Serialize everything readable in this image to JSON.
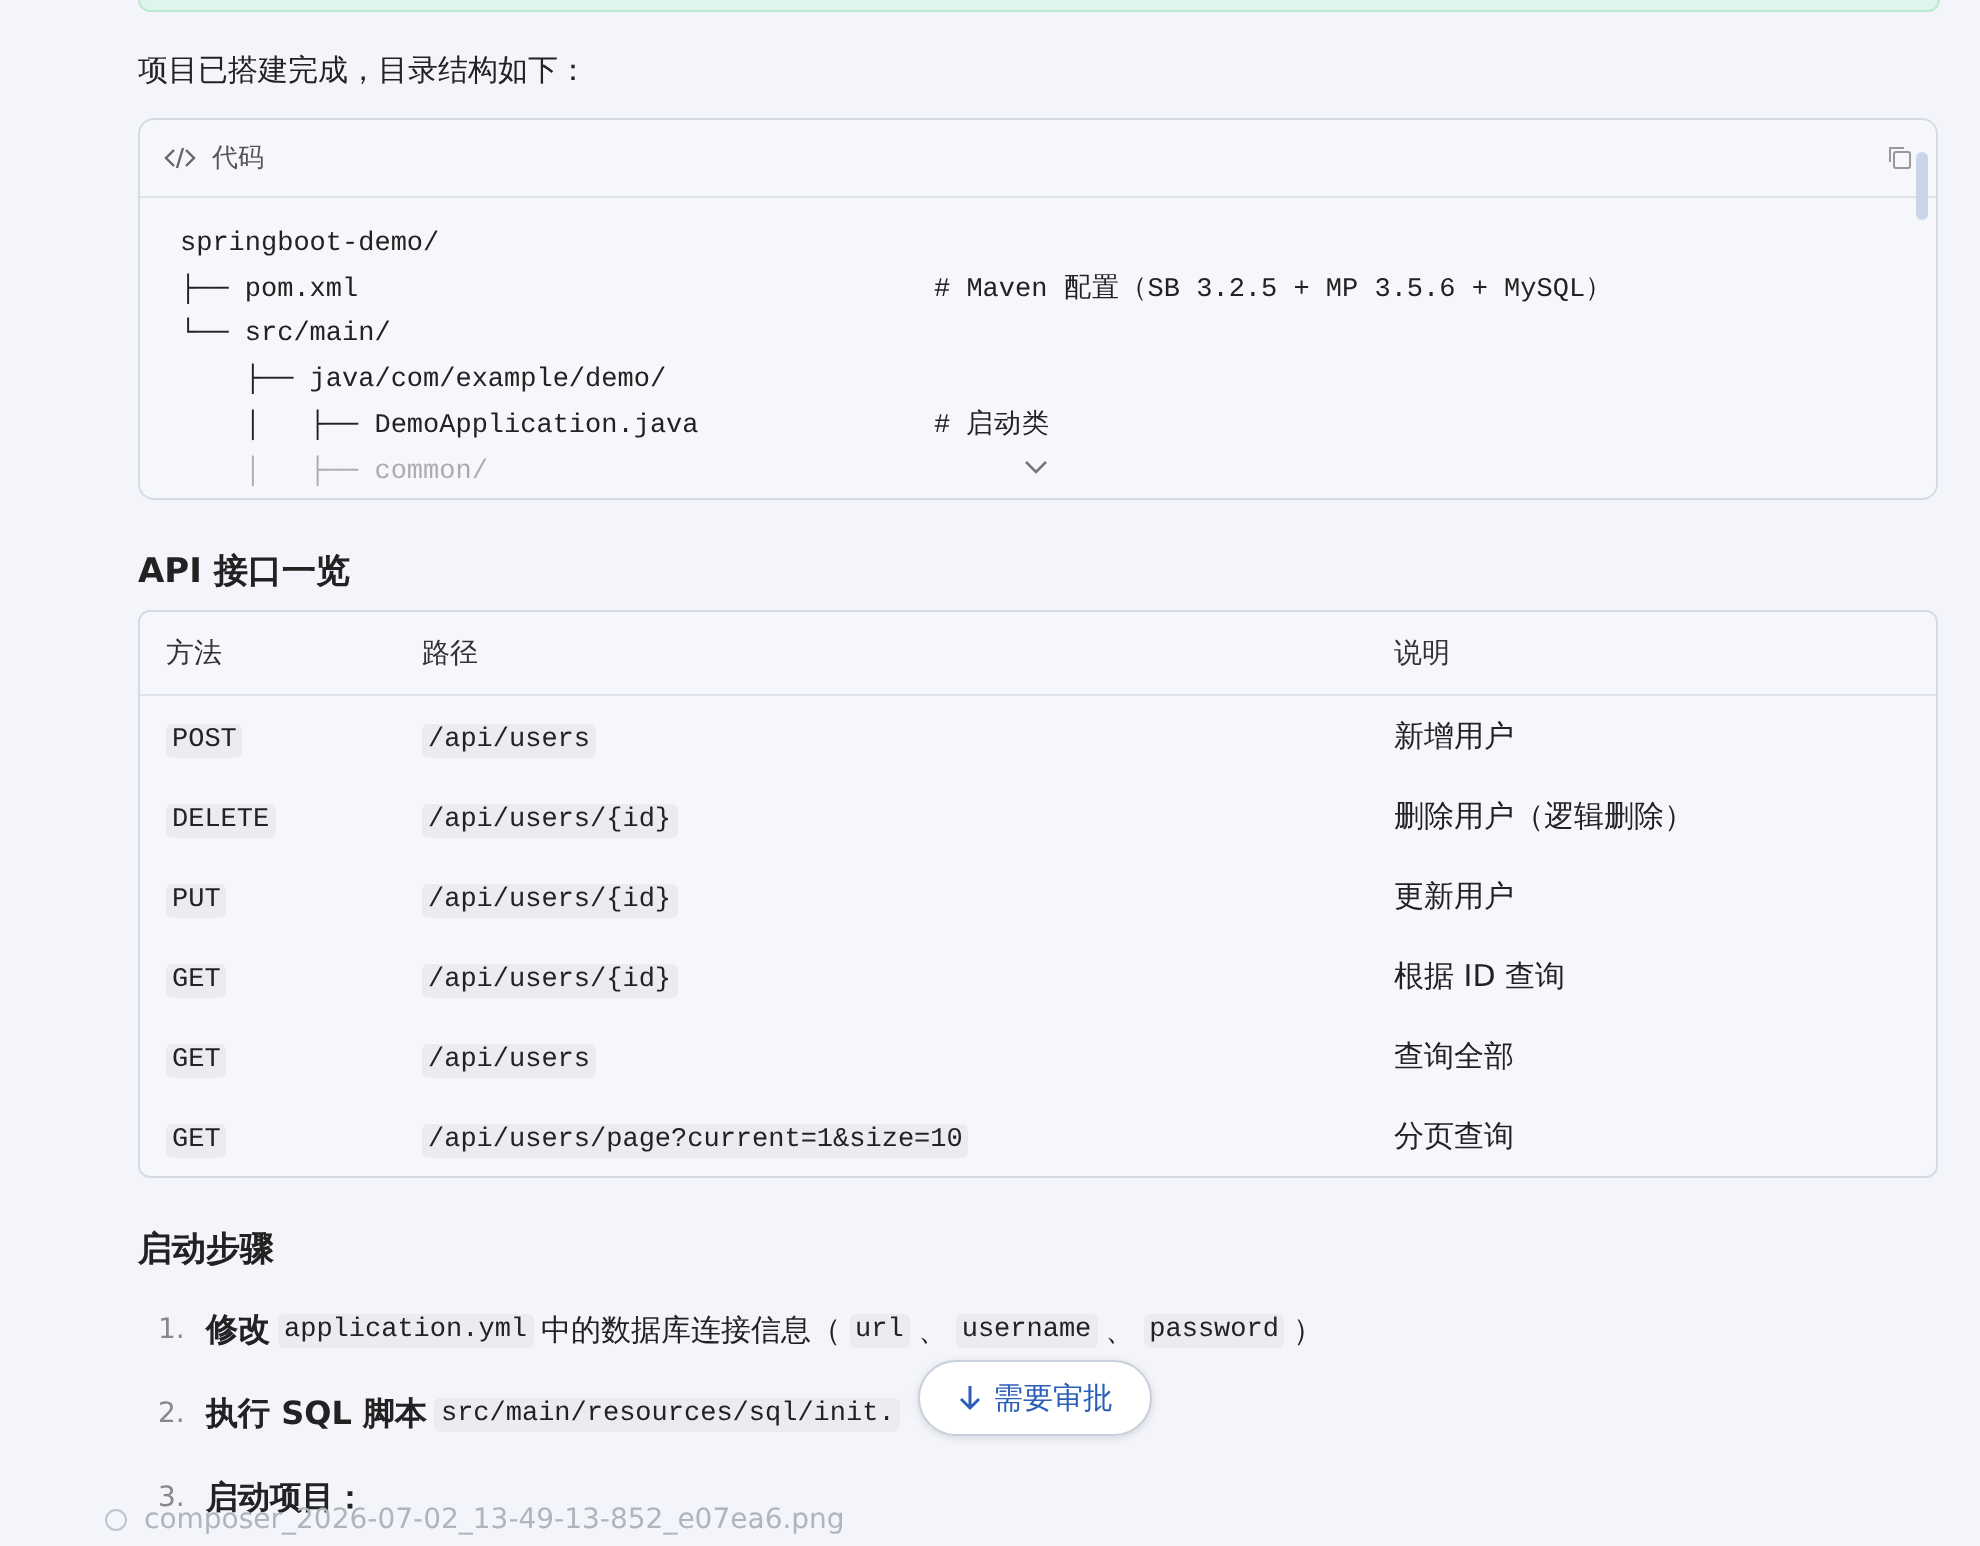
{
  "intro": "项目已搭建完成，目录结构如下：",
  "code_block": {
    "language_label": "代码",
    "lines": [
      {
        "text": "springboot-demo/",
        "faded": false
      },
      {
        "text": "├── pom.xml",
        "comment": "# Maven 配置（SB 3.2.5 + MP 3.5.6 + MySQL）",
        "faded": false
      },
      {
        "text": "└── src/main/",
        "faded": false
      },
      {
        "text": "    ├── java/com/example/demo/",
        "faded": false
      },
      {
        "text": "    │   ├── DemoApplication.java",
        "comment": "# 启动类",
        "faded": false
      },
      {
        "text": "    │   ├── common/",
        "faded": true
      }
    ]
  },
  "api_heading": "API 接口一览",
  "table": {
    "columns": [
      "方法",
      "路径",
      "说明"
    ],
    "rows": [
      [
        "POST",
        "/api/users",
        "新增用户"
      ],
      [
        "DELETE",
        "/api/users/{id}",
        "删除用户（逻辑删除）"
      ],
      [
        "PUT",
        "/api/users/{id}",
        "更新用户"
      ],
      [
        "GET",
        "/api/users/{id}",
        "根据 ID 查询"
      ],
      [
        "GET",
        "/api/users",
        "查询全部"
      ],
      [
        "GET",
        "/api/users/page?current=1&size=10",
        "分页查询"
      ]
    ]
  },
  "steps_heading": "启动步骤",
  "steps": [
    {
      "number": "1.",
      "parts": [
        {
          "kind": "bold",
          "text": "修改"
        },
        {
          "kind": "code",
          "text": "application.yml"
        },
        {
          "kind": "text",
          "text": "中的数据库连接信息（"
        },
        {
          "kind": "code",
          "text": "url"
        },
        {
          "kind": "text",
          "text": "、"
        },
        {
          "kind": "code",
          "text": "username"
        },
        {
          "kind": "text",
          "text": "、"
        },
        {
          "kind": "code",
          "text": "password"
        },
        {
          "kind": "text",
          "text": "）"
        }
      ]
    },
    {
      "number": "2.",
      "parts": [
        {
          "kind": "bold",
          "text": "执行 SQL 脚本"
        },
        {
          "kind": "code",
          "text": "src/main/resources/sql/init."
        }
      ]
    },
    {
      "number": "3.",
      "parts": [
        {
          "kind": "bold",
          "text": "启动项目："
        }
      ]
    }
  ],
  "approval_button": "需要审批",
  "file_caption": "composer_2026-07-02_13-49-13-852_e07ea6.png"
}
